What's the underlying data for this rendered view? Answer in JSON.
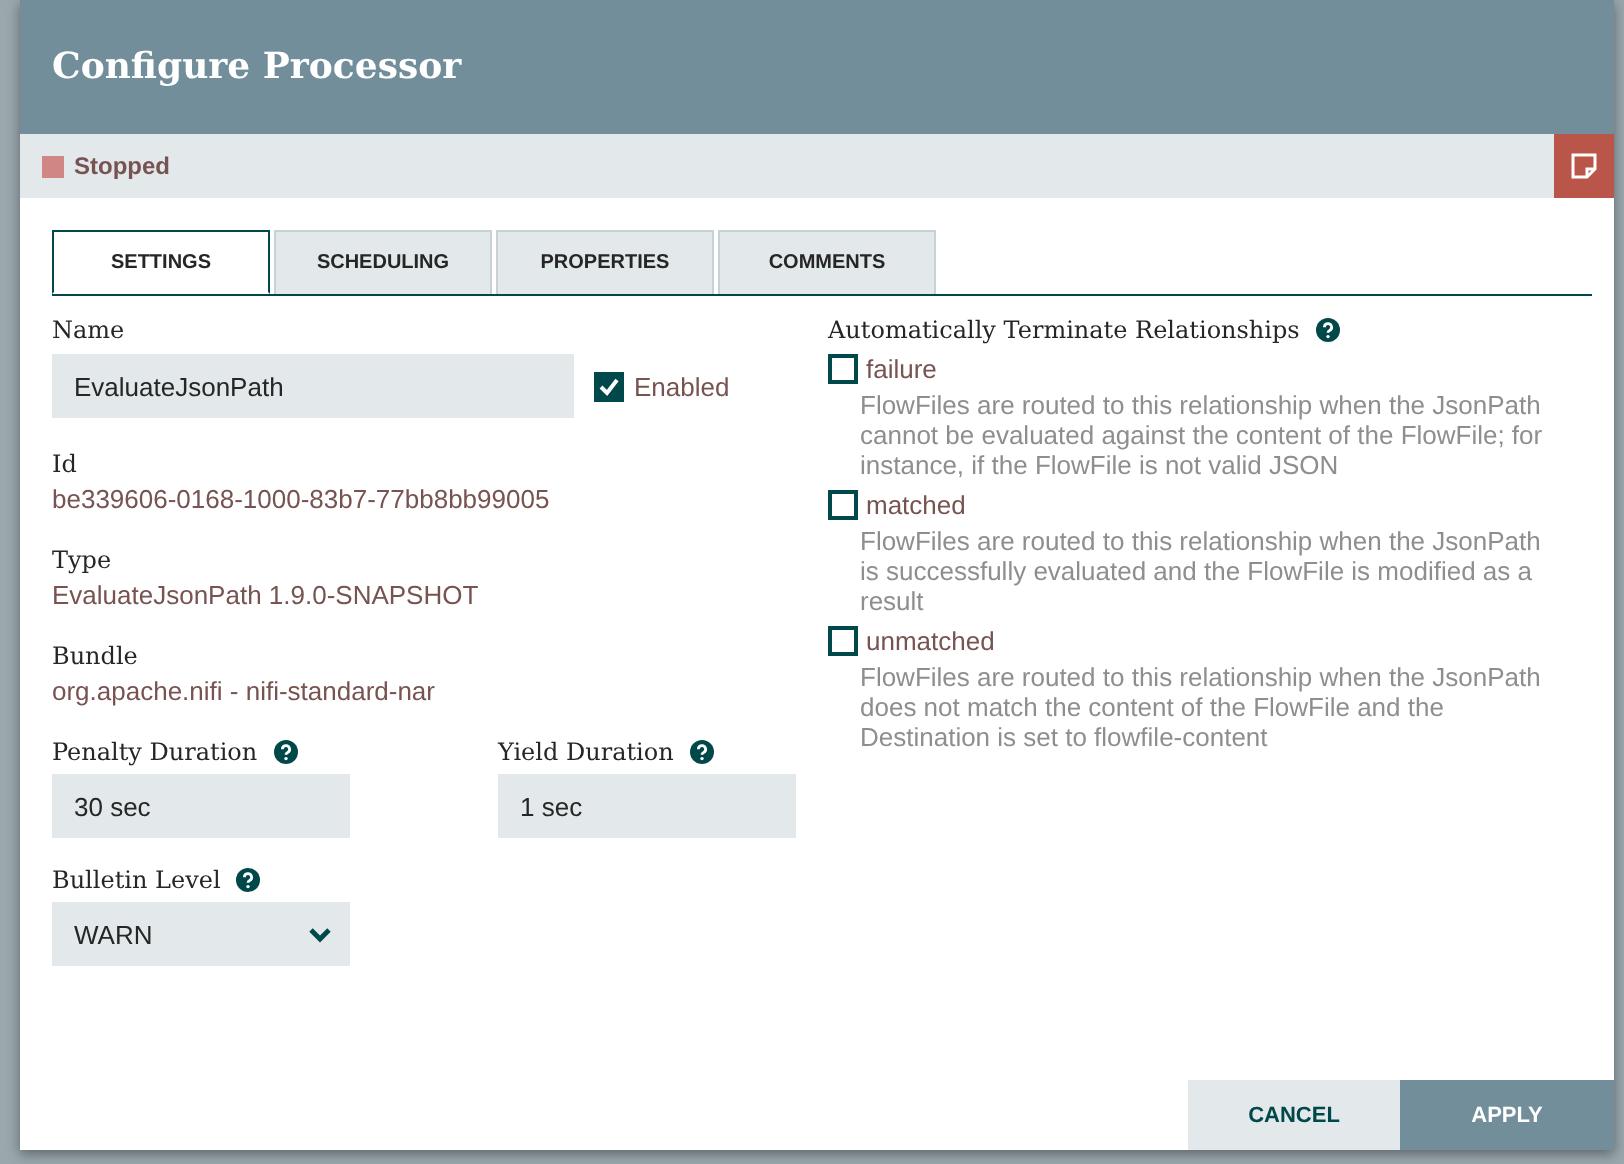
{
  "dialog": {
    "title": "Configure Processor"
  },
  "status": {
    "label": "Stopped"
  },
  "tabs": [
    {
      "label": "SETTINGS",
      "selected": true
    },
    {
      "label": "SCHEDULING",
      "selected": false
    },
    {
      "label": "PROPERTIES",
      "selected": false
    },
    {
      "label": "COMMENTS",
      "selected": false
    }
  ],
  "settings": {
    "name": {
      "label": "Name",
      "value": "EvaluateJsonPath"
    },
    "enabled": {
      "label": "Enabled",
      "checked": true
    },
    "id": {
      "label": "Id",
      "value": "be339606-0168-1000-83b7-77bb8bb99005"
    },
    "type": {
      "label": "Type",
      "value": "EvaluateJsonPath 1.9.0-SNAPSHOT"
    },
    "bundle": {
      "label": "Bundle",
      "value": "org.apache.nifi - nifi-standard-nar"
    },
    "penalty_duration": {
      "label": "Penalty Duration",
      "value": "30 sec"
    },
    "yield_duration": {
      "label": "Yield Duration",
      "value": "1 sec"
    },
    "bulletin_level": {
      "label": "Bulletin Level",
      "value": "WARN"
    }
  },
  "relationships": {
    "label": "Automatically Terminate Relationships",
    "items": [
      {
        "name": "failure",
        "checked": false,
        "description": "FlowFiles are routed to this relationship when the JsonPath cannot be evaluated against the content of the FlowFile; for instance, if the FlowFile is not valid JSON"
      },
      {
        "name": "matched",
        "checked": false,
        "description": "FlowFiles are routed to this relationship when the JsonPath is successfully evaluated and the FlowFile is modified as a result"
      },
      {
        "name": "unmatched",
        "checked": false,
        "description": "FlowFiles are routed to this relationship when the JsonPath does not match the content of the FlowFile and the Destination is set to flowfile-content"
      }
    ]
  },
  "buttons": [
    {
      "label": "CANCEL",
      "kind": "secondary"
    },
    {
      "label": "APPLY",
      "kind": "primary"
    }
  ]
}
